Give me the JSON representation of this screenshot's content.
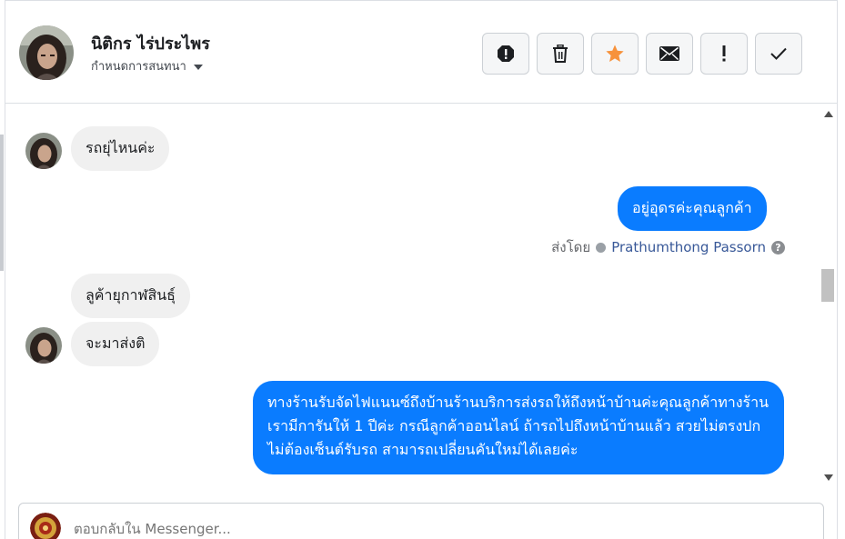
{
  "header": {
    "contact_name": "นิติกร ไร่ประไพร",
    "conversation_setting": "กำหนดการสนทนา",
    "toolbar_icons": [
      "report-icon",
      "trash-icon",
      "star-icon",
      "mail-icon",
      "exclamation-icon",
      "check-icon"
    ],
    "colors": {
      "star": "#f7923b"
    }
  },
  "messages": [
    {
      "direction": "incoming",
      "text": "รถยุ่ไหนค่ะ"
    },
    {
      "direction": "outgoing",
      "text": "อยู่อุดรค่ะคุณลูกค้า"
    },
    {
      "direction": "incoming",
      "text": "ลูค้ายุกาฬสินธุ์"
    },
    {
      "direction": "incoming",
      "text": "จะมาส่งติ"
    },
    {
      "direction": "outgoing",
      "text": "ทางร้านรับจัดไฟแนนซ์ถึงบ้านร้านบริการส่งรถให้ถึงหน้าบ้านค่ะคุณลูกค้าทางร้านเรามีการันให้ 1 ปีค่ะ กรณีลูกค้าออนไลน์ ถ้ารถไปถึงหน้าบ้านแล้ว สวยไม่ตรงปก ไม่ต้องเซ็นต์รับรถ สามารถเปลี่ยนคันใหม่ได้เลยค่ะ"
    }
  ],
  "sent_by": {
    "label": "ส่งโดย",
    "sender": "Prathumthong Passorn"
  },
  "composer": {
    "placeholder": "ตอบกลับใน Messenger..."
  },
  "colors": {
    "outgoing_bubble": "#0a7cff",
    "incoming_bubble": "#f0f0f0"
  }
}
